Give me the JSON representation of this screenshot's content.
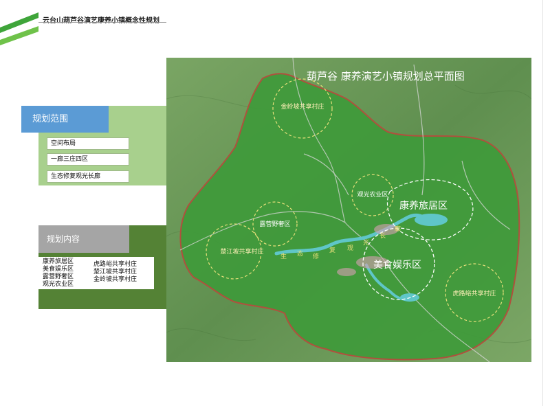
{
  "header": {
    "title": "云台山葫芦谷演艺康养小镇概念性规划"
  },
  "sections": {
    "scope": {
      "title": "规划范围",
      "items": [
        "空间布局",
        "一廊三庄四区",
        "生态修复观光长廊"
      ]
    },
    "content": {
      "title": "规划内容",
      "col1": [
        "康养旅居区",
        "美食娱乐区",
        "露营野奢区",
        "观光农业区"
      ],
      "col2": [
        "虎路峪共享村庄",
        "楚江坡共享村庄",
        "金岭坡共享村庄"
      ]
    }
  },
  "map": {
    "title": "葫芦谷 康养演艺小镇规划总平面图",
    "zones": [
      {
        "label": "康养旅居区"
      },
      {
        "label": "美食娱乐区"
      },
      {
        "label": "露营野奢区"
      },
      {
        "label": "观光农业区"
      },
      {
        "label": "金岭坡共享村庄"
      },
      {
        "label": "楚江坡共享村庄"
      },
      {
        "label": "虎路峪共享村庄"
      }
    ],
    "corridor_chars": [
      "生",
      "态",
      "修",
      "复",
      "观",
      "光",
      "长",
      "廊"
    ],
    "colors": {
      "boundary": "#b0503d",
      "planning_area": "#3e9a3a",
      "terrain": "#6f9a5a",
      "water": "#5fc6c8",
      "circle_yellow": "#e8e07a",
      "circle_white": "#ffffff",
      "road": "#d8d8d8"
    }
  }
}
